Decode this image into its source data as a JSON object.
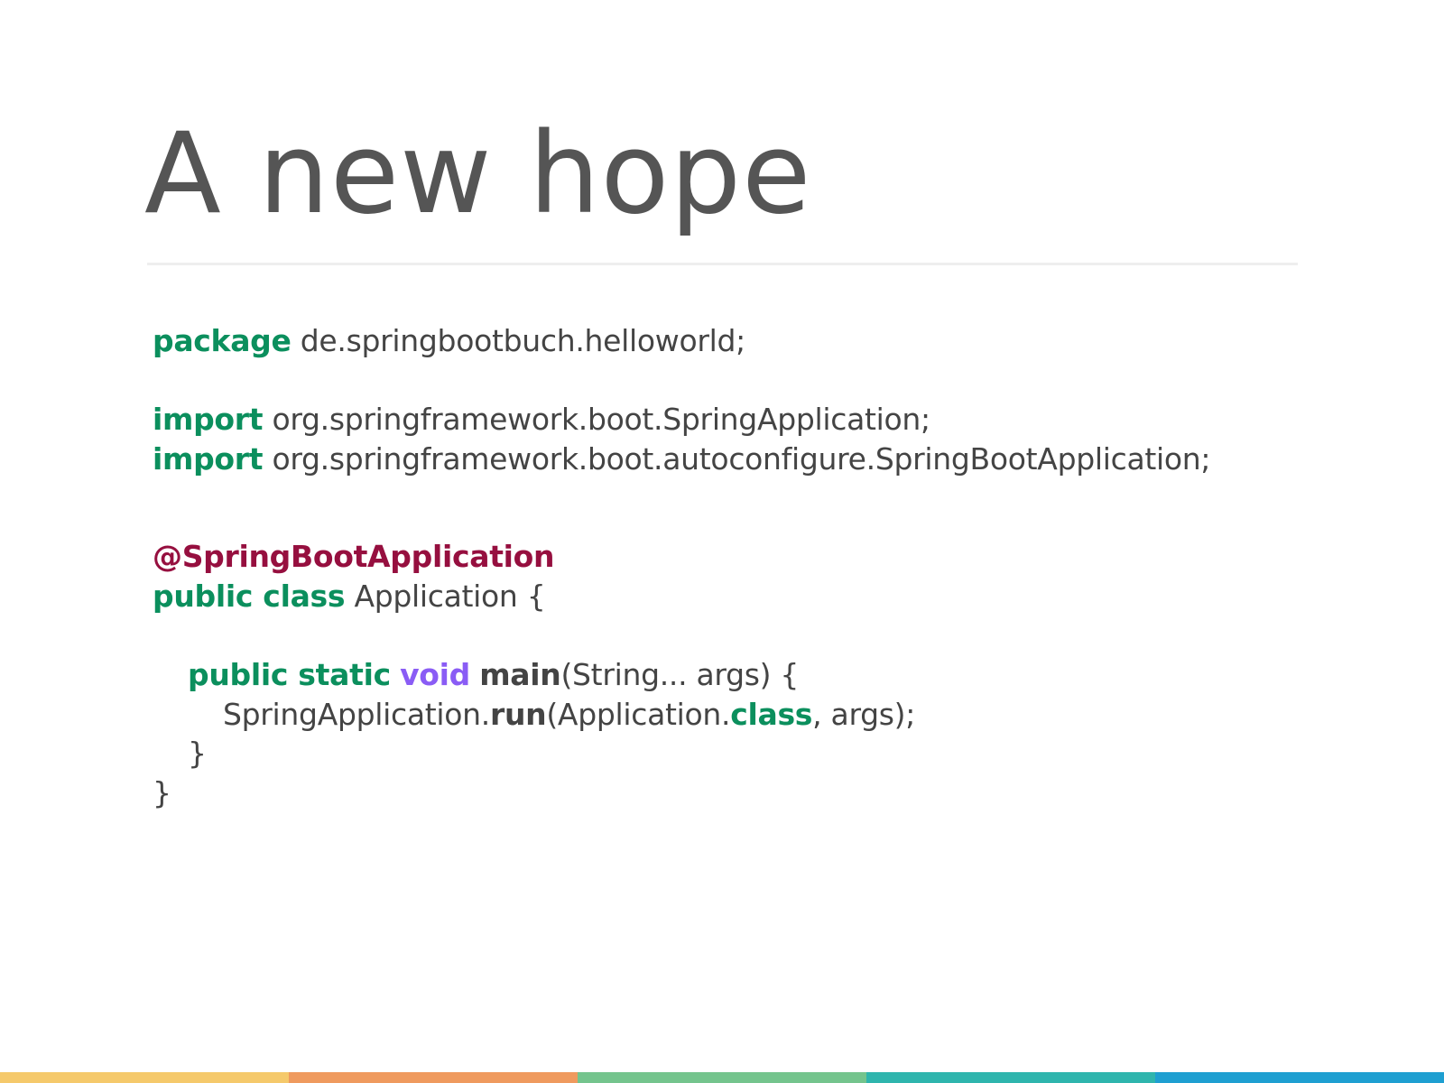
{
  "slide": {
    "title": "A new hope",
    "code": {
      "l1": {
        "kw": "package",
        "rest": " de.springbootbuch.helloworld;"
      },
      "l3": {
        "kw": "import",
        "rest": " org.springframework.boot.SpringApplication;"
      },
      "l4": {
        "kw": "import",
        "rest": " org.springframework.boot.autoconfigure.SpringBootApplication;"
      },
      "l6": {
        "anno": "@SpringBootApplication"
      },
      "l7": {
        "kw": "public class",
        "rest": " Application {"
      },
      "l9": {
        "kw": "public static",
        "sp": " ",
        "kw2": "void",
        "sp2": " ",
        "fn": "main",
        "rest": "(String... args) {"
      },
      "l10": {
        "pre": "SpringApplication.",
        "fn": "run",
        "mid": "(Application.",
        "kw": "class",
        "rest": ", args);"
      },
      "l11": {
        "text": "}"
      },
      "l12": {
        "text": "}"
      }
    }
  },
  "colors": {
    "title": "#555555",
    "keyword": "#0b8f5d",
    "annotation": "#960f3f",
    "void_keyword": "#8a5cf5",
    "code_text": "#444444",
    "bottom_bar": [
      "#f5c96b",
      "#ef9a5e",
      "#74c48d",
      "#2fb5ad",
      "#1e9fd1"
    ]
  }
}
